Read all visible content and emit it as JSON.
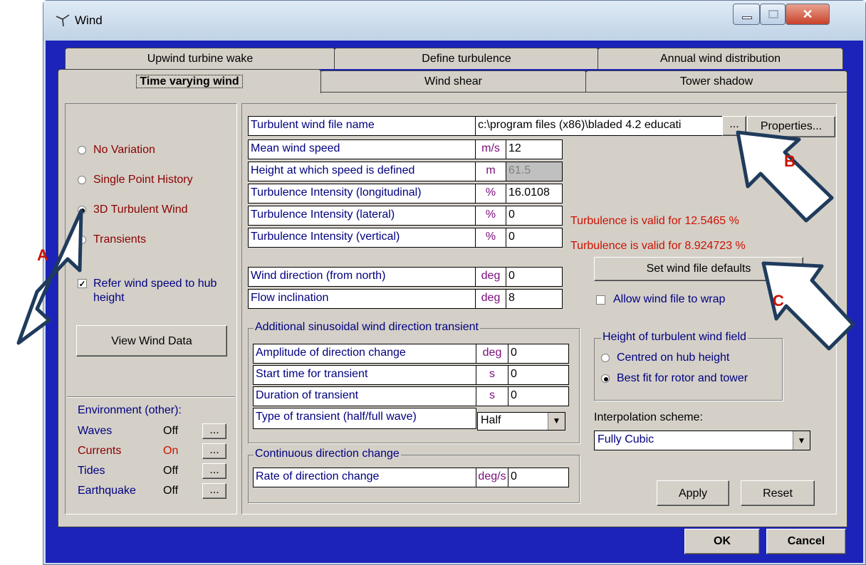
{
  "window": {
    "title": "Wind"
  },
  "tabs": {
    "row1": [
      "Upwind turbine wake",
      "Define turbulence",
      "Annual wind distribution"
    ],
    "row2": [
      "Time varying wind",
      "Wind shear",
      "Tower shadow"
    ]
  },
  "left": {
    "radios": [
      "No Variation",
      "Single Point History",
      "3D Turbulent Wind",
      "Transients"
    ],
    "selected": "3D Turbulent Wind",
    "refer_checkbox": "Refer wind speed to hub height",
    "view_button": "View Wind Data",
    "environment_label": "Environment (other):",
    "environment": [
      {
        "name": "Waves",
        "value": "Off",
        "btn": "..."
      },
      {
        "name": "Currents",
        "value": "On",
        "btn": "..."
      },
      {
        "name": "Tides",
        "value": "Off",
        "btn": "..."
      },
      {
        "name": "Earthquake",
        "value": "Off",
        "btn": "..."
      }
    ]
  },
  "main": {
    "file_label": "Turbulent wind file name",
    "file_value": "c:\\program files (x86)\\bladed 4.2 educati",
    "browse_btn": "...",
    "properties_btn": "Properties...",
    "rows": [
      {
        "label": "Mean wind speed",
        "unit": "m/s",
        "value": "12"
      },
      {
        "label": "Height at which speed is defined",
        "unit": "m",
        "value": "61.5"
      },
      {
        "label": "Turbulence Intensity (longitudinal)",
        "unit": "%",
        "value": "16.0108"
      },
      {
        "label": "Turbulence Intensity (lateral)",
        "unit": "%",
        "value": "0"
      },
      {
        "label": "Turbulence Intensity (vertical)",
        "unit": "%",
        "value": "0"
      }
    ],
    "valid1": "Turbulence is valid for  12.5465 %",
    "valid2": "Turbulence is valid for  8.924723 %",
    "direction_rows": [
      {
        "label": "Wind direction (from north)",
        "unit": "deg",
        "value": "0"
      },
      {
        "label": "Flow inclination",
        "unit": "deg",
        "value": "8"
      }
    ],
    "set_defaults_btn": "Set wind file defaults",
    "allow_wrap": "Allow wind file to wrap",
    "transient_group": "Additional sinusoidal wind direction transient",
    "transient_rows": [
      {
        "label": "Amplitude of direction change",
        "unit": "deg",
        "value": "0"
      },
      {
        "label": "Start time for transient",
        "unit": "s",
        "value": "0"
      },
      {
        "label": "Duration of transient",
        "unit": "s",
        "value": "0"
      }
    ],
    "transient_type_label": "Type of transient (half/full wave)",
    "transient_type_value": "Half",
    "continuous_group": "Continuous direction change",
    "rate_label": "Rate of direction change",
    "rate_unit": "deg/s",
    "rate_value": "0",
    "height_group": "Height of turbulent wind field",
    "height_options": [
      "Centred on hub height",
      "Best fit for rotor and tower"
    ],
    "height_selected": "Best fit for rotor and tower",
    "interp_label": "Interpolation scheme:",
    "interp_value": "Fully Cubic",
    "apply_btn": "Apply",
    "reset_btn": "Reset"
  },
  "footer": {
    "ok": "OK",
    "cancel": "Cancel"
  },
  "annotations": [
    "A",
    "B",
    "C"
  ]
}
